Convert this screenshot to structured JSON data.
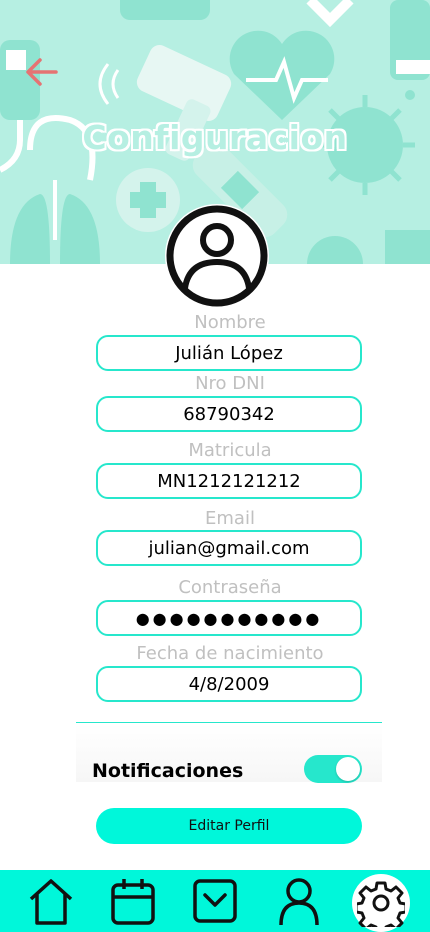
{
  "header": {
    "title": "Configuracion",
    "back_icon": "arrow-left-icon"
  },
  "profile": {
    "avatar_icon": "user-circle-icon",
    "fields": [
      {
        "label": "Nombre",
        "value": "Julián López"
      },
      {
        "label": "Nro DNI",
        "value": "68790342"
      },
      {
        "label": "Matricula",
        "value": "MN1212121212"
      },
      {
        "label": "Email",
        "value": "julian@gmail.com"
      },
      {
        "label": "Contraseña",
        "value": "●●●●●●●●●●●"
      },
      {
        "label": "Fecha de nacimiento",
        "value": "4/8/2009"
      }
    ]
  },
  "settings": {
    "notifications_label": "Notificaciones",
    "notifications_enabled": true,
    "edit_button_label": "Editar Perfil"
  },
  "nav": {
    "items": [
      {
        "icon": "home-icon"
      },
      {
        "icon": "calendar-icon"
      },
      {
        "icon": "inbox-icon"
      },
      {
        "icon": "user-icon"
      },
      {
        "icon": "gear-icon",
        "active": true
      }
    ]
  },
  "colors": {
    "accent": "#00f7da",
    "border": "#26e7cc",
    "hero_bg": "#b6efe2",
    "label": "#c0c0c0",
    "back_arrow": "#e57373"
  }
}
